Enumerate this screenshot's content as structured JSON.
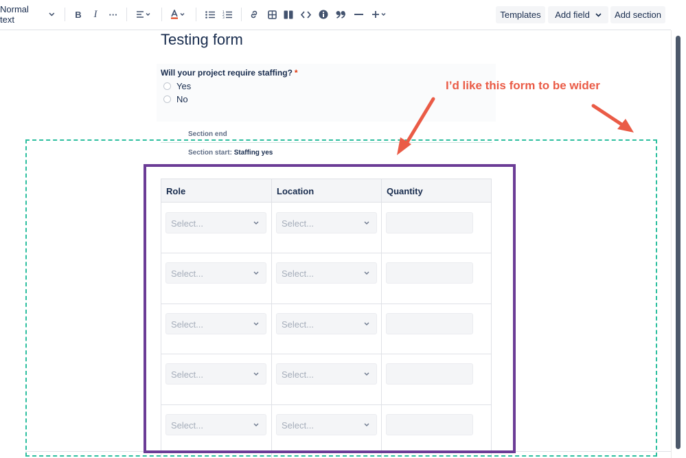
{
  "toolbar": {
    "text_style": "Normal text",
    "tools": [
      {
        "name": "bold-icon",
        "glyph": "B"
      },
      {
        "name": "italic-icon",
        "glyph": "I"
      },
      {
        "name": "more-formatting-icon",
        "glyph": "···"
      }
    ],
    "templates_label": "Templates",
    "add_field_label": "Add field",
    "add_section_label": "Add section"
  },
  "form": {
    "title": "Testing form",
    "question": "Will your project require staffing?",
    "required_mark": "*",
    "options": [
      "Yes",
      "No"
    ],
    "section_end": "Section end",
    "section_start_prefix": "Section start: ",
    "section_start_name": "Staffing yes"
  },
  "table": {
    "columns": [
      "Role",
      "Location",
      "Quantity"
    ],
    "placeholder": "Select...",
    "row_count": 5
  },
  "annotation": {
    "text": "I’d like this form to be wider",
    "color": "#ea5b46",
    "box_color_dashed": "#2dbf9f",
    "box_color_solid": "#6b3c96"
  }
}
